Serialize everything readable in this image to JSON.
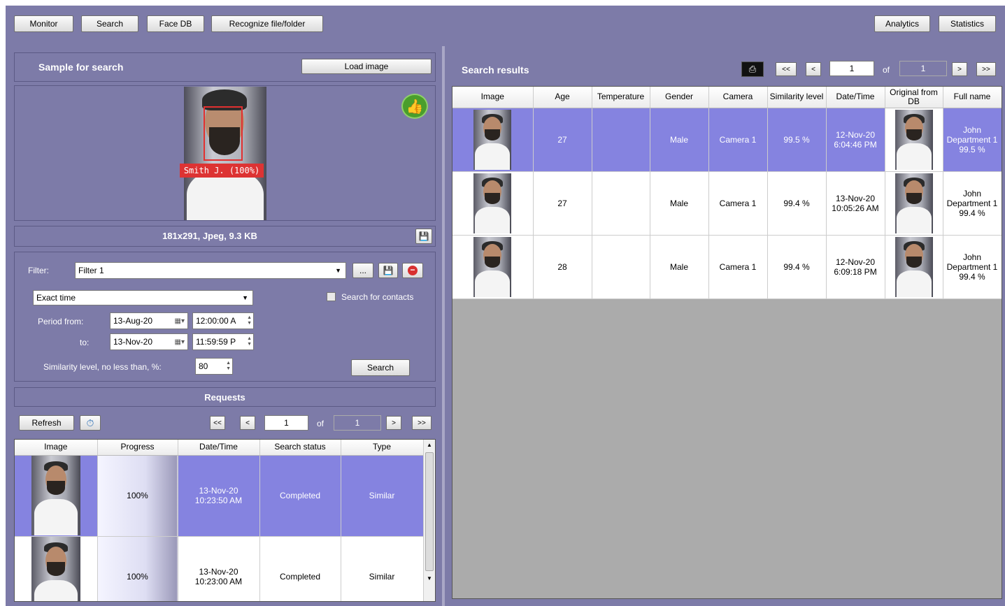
{
  "toolbar": {
    "monitor": "Monitor",
    "search": "Search",
    "face_db": "Face DB",
    "recognize": "Recognize file/folder",
    "analytics": "Analytics",
    "statistics": "Statistics"
  },
  "sample": {
    "title": "Sample for search",
    "load_image": "Load image",
    "face_label": "Smith J. (100%)",
    "file_info": "181x291, Jpeg, 9.3 KB"
  },
  "filter": {
    "label": "Filter:",
    "value": "Filter 1",
    "ellipsis": "...",
    "mode": "Exact time",
    "search_contacts": "Search for contacts",
    "period_from_label": "Period from:",
    "to_label": "to:",
    "from_date": "13-Aug-20",
    "from_time": "12:00:00 A",
    "to_date": "13-Nov-20",
    "to_time": "11:59:59 P",
    "similarity_label": "Similarity level, no less than, %:",
    "similarity_value": "80",
    "search_btn": "Search"
  },
  "requests": {
    "title": "Requests",
    "refresh": "Refresh",
    "page": "1",
    "of": "of",
    "total": "1",
    "first": "<<",
    "prev": "<",
    "next": ">",
    "last": ">>",
    "columns": [
      "Image",
      "Progress",
      "Date/Time",
      "Search status",
      "Type"
    ],
    "rows": [
      {
        "progress": "100%",
        "date": "13-Nov-20",
        "time": "10:23:50 AM",
        "status": "Completed",
        "type": "Similar"
      },
      {
        "progress": "100%",
        "date": "13-Nov-20",
        "time": "10:23:00 AM",
        "status": "Completed",
        "type": "Similar"
      }
    ]
  },
  "results": {
    "title": "Search results",
    "page": "1",
    "of": "of",
    "total": "1",
    "first": "<<",
    "prev": "<",
    "next": ">",
    "last": ">>",
    "columns": [
      "Image",
      "Age",
      "Temperature",
      "Gender",
      "Camera",
      "Similarity level",
      "Date/Time",
      "Original from DB",
      "Full name"
    ],
    "rows": [
      {
        "age": "27",
        "temperature": "",
        "gender": "Male",
        "camera": "Camera 1",
        "similarity": "99.5 %",
        "date": "12-Nov-20",
        "time": "6:04:46 PM",
        "name1": "John",
        "name2": "Department 1",
        "name3": "99.5 %"
      },
      {
        "age": "27",
        "temperature": "",
        "gender": "Male",
        "camera": "Camera 1",
        "similarity": "99.4 %",
        "date": "13-Nov-20",
        "time": "10:05:26 AM",
        "name1": "John",
        "name2": "Department 1",
        "name3": "99.4 %"
      },
      {
        "age": "28",
        "temperature": "",
        "gender": "Male",
        "camera": "Camera 1",
        "similarity": "99.4 %",
        "date": "12-Nov-20",
        "time": "6:09:18 PM",
        "name1": "John",
        "name2": "Department 1",
        "name3": "99.4 %"
      }
    ]
  }
}
